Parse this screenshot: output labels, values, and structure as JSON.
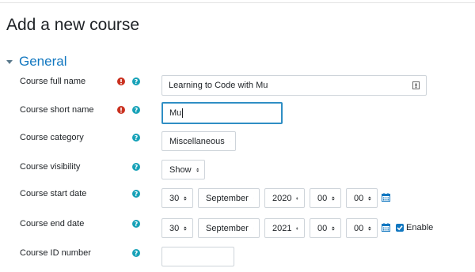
{
  "page": {
    "title": "Add a new course"
  },
  "section": {
    "title": "General"
  },
  "fields": {
    "full_name": {
      "label": "Course full name",
      "value": "Learning to Code with Mu"
    },
    "short_name": {
      "label": "Course short name",
      "value": "Mu"
    },
    "category": {
      "label": "Course category",
      "value": "Miscellaneous"
    },
    "visibility": {
      "label": "Course visibility",
      "value": "Show"
    },
    "start_date": {
      "label": "Course start date",
      "day": "30",
      "month": "September",
      "year": "2020",
      "hour": "00",
      "minute": "00"
    },
    "end_date": {
      "label": "Course end date",
      "day": "30",
      "month": "September",
      "year": "2021",
      "hour": "00",
      "minute": "00",
      "enable_label": "Enable",
      "enabled": true
    },
    "id_number": {
      "label": "Course ID number",
      "value": ""
    }
  },
  "colors": {
    "accent": "#1177c0",
    "required": "#ca3120",
    "help": "#17a2b8",
    "focus": "#2f8ec4"
  },
  "icons": {
    "required": "exclamation-circle-icon",
    "help": "question-circle-icon",
    "calendar": "calendar-icon",
    "lock": "lock-icon"
  }
}
